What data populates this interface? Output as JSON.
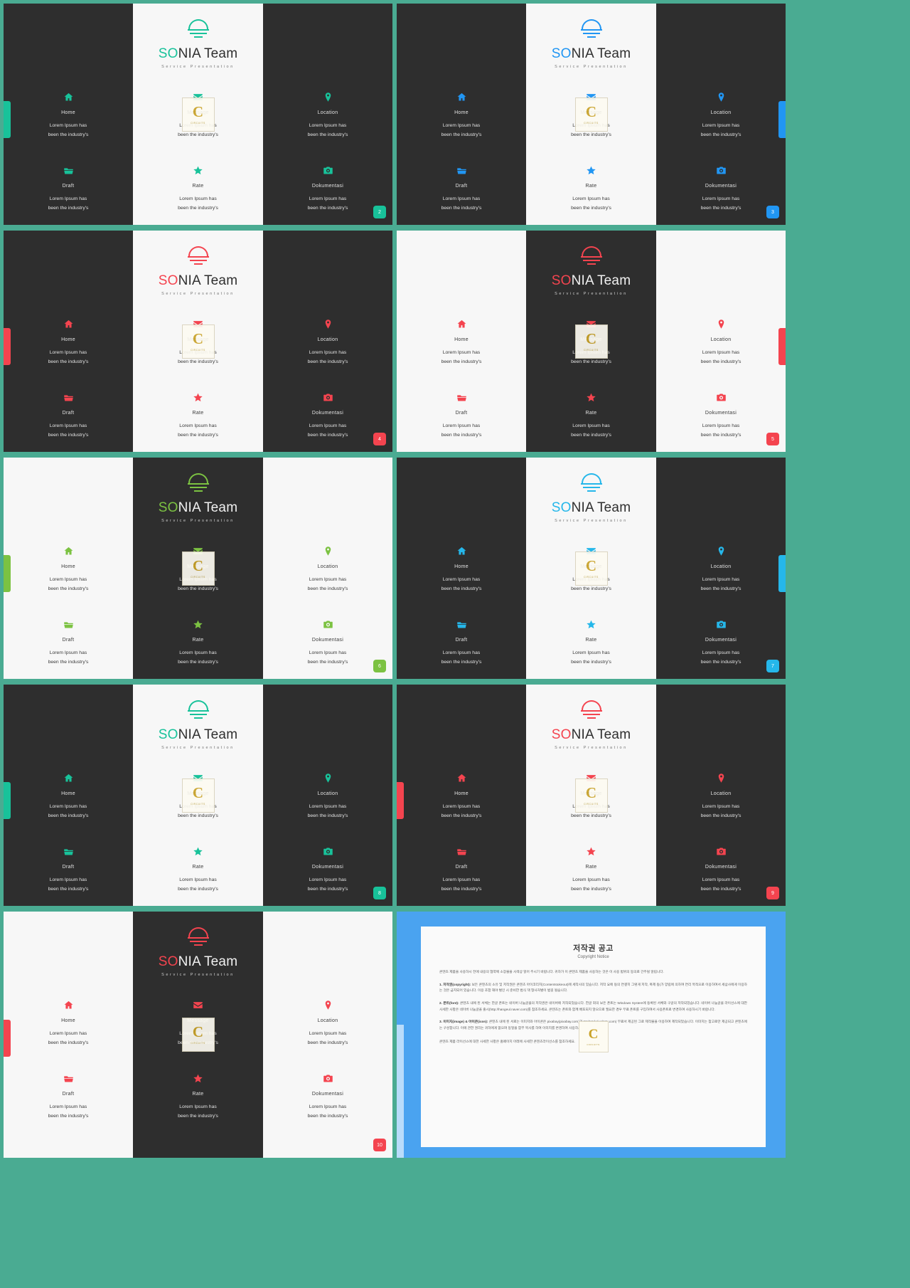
{
  "brand": {
    "name_accent": "SO",
    "name_rest": "NIA Team",
    "tagline": "Service Presentation",
    "logo_icon": "dome-sunset-logo-icon"
  },
  "features": {
    "body_line1": "Lorem Ipsum has",
    "body_line2": "been the industry's",
    "items": [
      {
        "key": "home",
        "title": "Home",
        "icon": "home-icon"
      },
      {
        "key": "draft",
        "title": "Draft",
        "icon": "folder-icon"
      },
      {
        "key": "msg",
        "title": "Message",
        "icon": "envelope-icon"
      },
      {
        "key": "rate",
        "title": "Rate",
        "icon": "star-icon"
      },
      {
        "key": "loc",
        "title": "Location",
        "icon": "map-pin-icon"
      },
      {
        "key": "doc",
        "title": "Dokumentasi",
        "icon": "camera-icon"
      }
    ]
  },
  "watermark": {
    "letter": "C",
    "label": "CIRCUITS"
  },
  "palette": {
    "teal": "#18c29a",
    "blue": "#2196f3",
    "red": "#f4444f",
    "green": "#7cc242",
    "cyan": "#25b7ea",
    "sheet_bg": "#4aab92",
    "dark_panel": "#2e2e2e",
    "light_panel": "#f7f7f7"
  },
  "slides": [
    {
      "num": "2",
      "accent": "#18c29a",
      "layout": "dark-light-dark",
      "tab": "left"
    },
    {
      "num": "3",
      "accent": "#2196f3",
      "layout": "dark-light-dark",
      "tab": "right"
    },
    {
      "num": "4",
      "accent": "#f4444f",
      "layout": "dark-light-dark",
      "tab": "left"
    },
    {
      "num": "5",
      "accent": "#f4444f",
      "layout": "light-dark-light",
      "tab": "right"
    },
    {
      "num": "6",
      "accent": "#7cc242",
      "layout": "light-dark-light",
      "tab": "left"
    },
    {
      "num": "7",
      "accent": "#25b7ea",
      "layout": "dark-light-dark",
      "tab": "right"
    },
    {
      "num": "8",
      "accent": "#18c29a",
      "layout": "dark-light-dark",
      "tab": "left"
    },
    {
      "num": "9",
      "accent": "#f4444f",
      "layout": "dark-light-dark",
      "tab": "left"
    },
    {
      "num": "10",
      "accent": "#f4444f",
      "layout": "light-dark-light",
      "tab": "left"
    }
  ],
  "copyright": {
    "title": "저작권 공고",
    "subtitle": "Copyright Notice",
    "intro": "콘텐츠 제품을 사용하시 전에 내용의 협약에 소장물을 사색상 읽어 주시기 바랍니다. 귀하가 이 콘텐츠 제품을 사용하는 것은 이 사용 범위의 동의로 간주될 알립니다.",
    "p1_label": "1. 저작권(copyright):",
    "p1": "보든 콘텐츠의 소유 및 저작권은 콘텐츠 아이코리지(Contentstokeout)에 세작사의 있습니다. 저작 요에 등의 연결히 그렇게 저작, 복제 등(가 양립에 의하여 연리 목적으로 이용하여서 세삼사에게 이용하는 것은 금지되어 있습니다. 이용 조합 해야 벌인 시 준비한 법식 책 형사처벌이 범길 될습니다.",
    "p2_label": "2. 폰트(font):",
    "p2": "콘텐츠 내에 된 서체는 한글 폰트는 네이버 나눔글꼴의 저작권은 네이버에 저작되었습니다. 한글 외의 보든 폰트는 Windows System에 등록된 서체와 구글의 저작되었습니다. 네이버 나눔글꼴 라이선스에 대한 사세한 사항은 네이버 나눔글꼴 출시(http://hangeul.naver.com)를 참조하세요. 콘텐츠는 폰트와 함께 배포되지 않으므로 필요한 경우 무료 폰트를 구입하여서 사용폰트로 변경하여 사용하시기 바랍니다.",
    "p3_label": "3. 이미지(image) & 아이콘(icon):",
    "p3": "콘텐츠 내에 된 서로는 이미지와 아이콘은 pixabay(pixabay.com)과 Webstyle(websty.com) 무료서 제공된 그로 제작물을 이용하여 제작되었습니다. 이미지는 참고로만 제공되고 콘텐츠에는 구성합니다. 이에 관한 권리는 귀하에게 없으며 동일을 함부 목사를 하여 이미지를 변경하여 사용하시기 바랍니다.",
    "footer": "콘텐츠 제품 라이선스에 대한 사세한 사항은 홈페이지 아래에 사세한 콘텐츠라이선스를 참조하세요."
  }
}
